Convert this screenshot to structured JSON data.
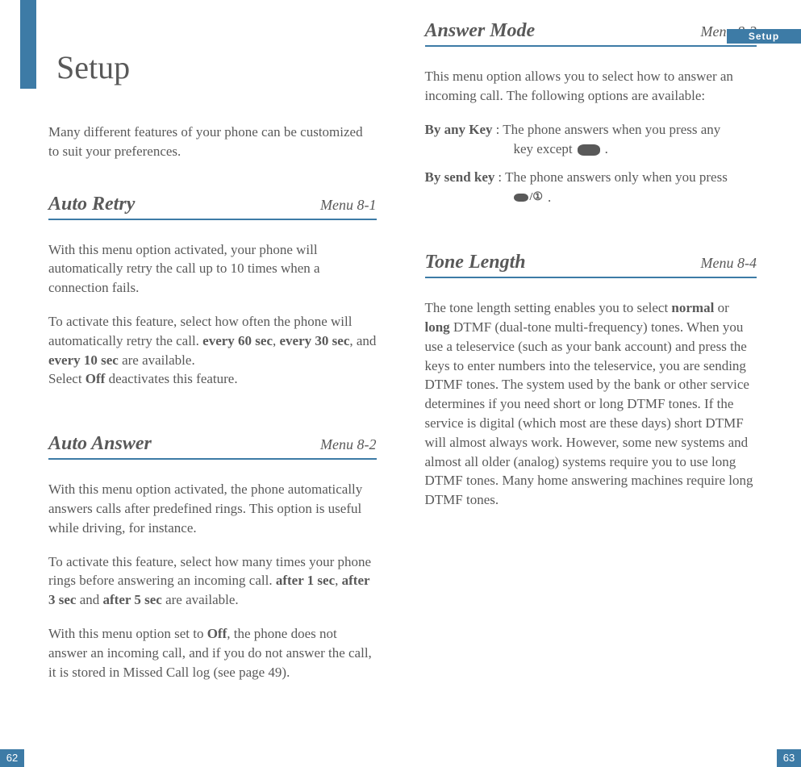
{
  "header_tab": "Setup",
  "page_left": {
    "title": "Setup",
    "intro": "Many different features of your phone can be customized to suit your preferences.",
    "page_number": "62",
    "sections": [
      {
        "title": "Auto Retry",
        "menu": "Menu  8-1",
        "p1": "With this menu option activated, your phone will automatically retry the call up to 10 times when a connection fails.",
        "p2_a": "To activate this feature, select how often the phone will automatically retry the call. ",
        "p2_b1": "every 60 sec",
        "p2_c": ", ",
        "p2_b2": "every 30 sec",
        "p2_d": ", and ",
        "p2_b3": "every 10 sec",
        "p2_e": " are available.",
        "p3_a": "Select ",
        "p3_b": "Off",
        "p3_c": " deactivates this feature."
      },
      {
        "title": "Auto Answer",
        "menu": "Menu 8-2",
        "p1": "With this menu option activated, the phone automatically answers calls after predefined rings. This option is useful while driving, for instance.",
        "p2_a": "To activate this feature, select how many times your phone rings before answering an incoming call.  ",
        "p2_b1": "after 1 sec",
        "p2_c": ",  ",
        "p2_b2": "after 3 sec",
        "p2_d": " and ",
        "p2_b3": "after 5 sec",
        "p2_e": "  are available.",
        "p3_a": "With this menu option set to ",
        "p3_b": "Off",
        "p3_c": ",  the phone does not answer an incoming call, and if you do not answer the call, it is stored in Missed Call log (see page 49)."
      }
    ]
  },
  "page_right": {
    "page_number": "63",
    "sections": [
      {
        "title": "Answer Mode",
        "menu": "Menu  8-3",
        "intro": "This menu option allows you to select how to answer an incoming call. The following options are available:",
        "opts": [
          {
            "key": "By any Key",
            "line1": ": The phone answers when you press any",
            "line2_a": "key except  ",
            "line2_b": " ."
          },
          {
            "key": "By send key",
            "line1": ": The phone answers only when you press",
            "line2_b": " ."
          }
        ]
      },
      {
        "title": "Tone Length",
        "menu": "Menu 8-4",
        "p_a": "The tone length setting enables you to select ",
        "p_b1": "normal",
        "p_c": " or ",
        "p_b2": "long",
        "p_d": " DTMF (dual-tone multi-frequency) tones. When you use a teleservice (such as your bank account) and press the keys to enter numbers into the teleservice, you are sending DTMF tones. The system used by the bank or other service determines if you need short or long DTMF tones. If the service is digital (which most are these days) short DTMF will almost always work. However, some new systems and almost all older (analog) systems require you to use long DTMF tones. Many home answering machines require long DTMF tones."
      }
    ]
  }
}
